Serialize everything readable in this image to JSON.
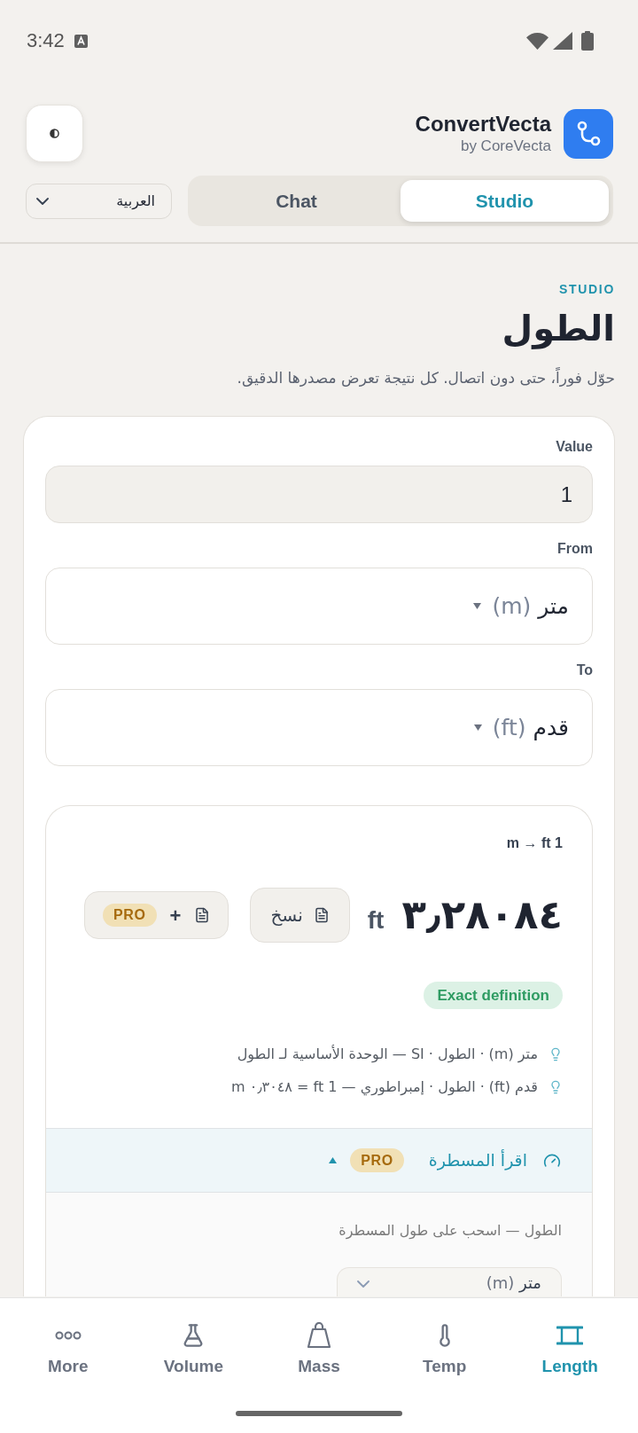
{
  "status_bar": {
    "time": "3:42"
  },
  "header": {
    "app_name": "ConvertVecta",
    "byline": "by CoreVecta",
    "language": "العربية",
    "tabs": [
      {
        "label": "Studio",
        "selected": true
      },
      {
        "label": "Chat",
        "selected": false
      }
    ]
  },
  "page": {
    "eyebrow": "STUDIO",
    "title": "الطول",
    "subtitle": "حوّل فوراً، حتى دون اتصال. كل نتيجة تعرض مصدرها الدقيق."
  },
  "converter": {
    "fields": [
      {
        "kind": "input",
        "label": "Value",
        "value": "1"
      },
      {
        "kind": "select",
        "label": "From",
        "value": "متر",
        "unit": "(m)"
      },
      {
        "kind": "select",
        "label": "To",
        "value": "قدم",
        "unit": "(ft)"
      }
    ]
  },
  "result": {
    "query": "1 m → ft",
    "value": "٣٫٢٨٠٨٤",
    "unit": "ft",
    "actions": [
      {
        "label": "نسخ"
      },
      {
        "label": "+",
        "badge": "PRO"
      }
    ],
    "badge": "Exact definition",
    "notes": [
      "متر (m) · الطول · SI — الوحدة الأساسية لـ الطول",
      "قدم (ft) · الطول · إمبراطوري — 1 ft = ٠٫٣٠٤٨ m"
    ],
    "ruler": {
      "title": "اقرأ المسطرة",
      "badge": "PRO",
      "expanded": true,
      "hint": "الطول — اسحب على طول المسطرة",
      "unit_select": {
        "value": "متر",
        "unit": "(m)"
      }
    }
  },
  "nav": {
    "items": [
      {
        "label": "Length",
        "selected": true
      },
      {
        "label": "Temp",
        "selected": false
      },
      {
        "label": "Mass",
        "selected": false
      },
      {
        "label": "Volume",
        "selected": false
      },
      {
        "label": "More",
        "selected": false
      }
    ]
  }
}
